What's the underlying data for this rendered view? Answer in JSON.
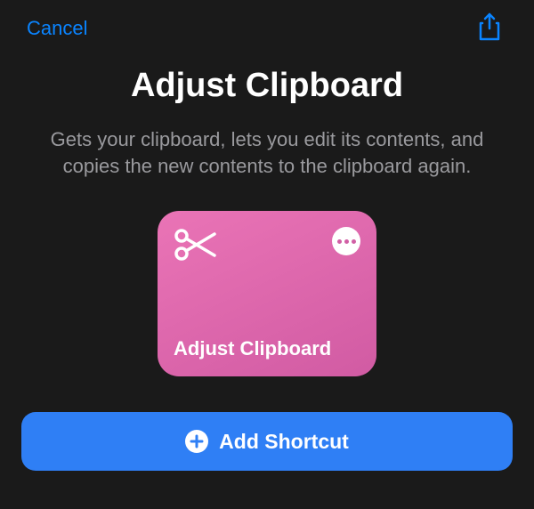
{
  "header": {
    "cancel_label": "Cancel"
  },
  "page": {
    "title": "Adjust Clipboard",
    "description": "Gets your clipboard, lets you edit its contents, and copies the new contents to the clipboard again."
  },
  "tile": {
    "label": "Adjust Clipboard",
    "icon": "scissors-icon",
    "menu_icon": "more-icon",
    "color": "#d960a5"
  },
  "action": {
    "add_label": "Add Shortcut",
    "icon": "plus-circle-icon"
  }
}
